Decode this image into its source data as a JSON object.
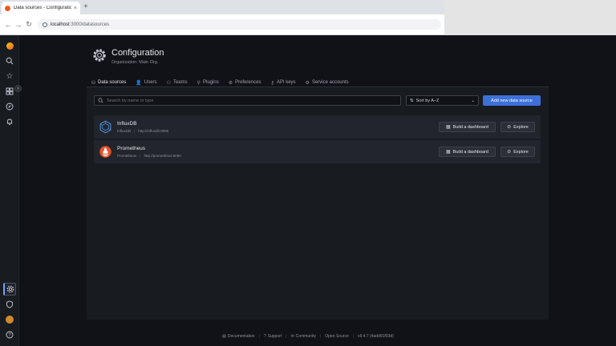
{
  "browser": {
    "tab_title": "Data sources - Configuration",
    "tab_close": "×",
    "new_tab": "+",
    "url_host": "localhost",
    "url_path": ":3000/datasources",
    "back": "←",
    "forward": "→",
    "reload": "↻"
  },
  "header": {
    "title": "Configuration",
    "subtitle": "Organization: Main Org."
  },
  "tabs": [
    {
      "label": "Data sources",
      "icon": "database-icon",
      "glyph": "⛁",
      "active": true
    },
    {
      "label": "Users",
      "icon": "user-icon",
      "glyph": "👤"
    },
    {
      "label": "Teams",
      "icon": "users-icon",
      "glyph": "⚇"
    },
    {
      "label": "Plugins",
      "icon": "plug-icon",
      "glyph": "⚲"
    },
    {
      "label": "Preferences",
      "icon": "sliders-icon",
      "glyph": "⚙"
    },
    {
      "label": "API keys",
      "icon": "key-icon",
      "glyph": "⚷"
    },
    {
      "label": "Service accounts",
      "icon": "service-account-icon",
      "glyph": "⚙"
    }
  ],
  "toolbar": {
    "search_placeholder": "Search by name or type",
    "sort_label": "Sort by A–Z",
    "add_button": "Add new data source"
  },
  "datasources": [
    {
      "name": "InfluxDB",
      "type": "InfluxDB",
      "url": "http://influxdb:8086",
      "build": "Build a dashboard",
      "explore": "Explore"
    },
    {
      "name": "Prometheus",
      "type": "Prometheus",
      "url": "http://prometheus:9090",
      "build": "Build a dashboard",
      "explore": "Explore"
    }
  ],
  "footer": {
    "documentation": "Documentation",
    "support": "Support",
    "community": "Community",
    "open_source": "Open Source",
    "version": "v9.4.7 (4add91f03d)"
  },
  "colors": {
    "accent": "#3d71d9",
    "tab_underline": "#ff9830",
    "background": "#111217",
    "panel": "#181b1f"
  }
}
